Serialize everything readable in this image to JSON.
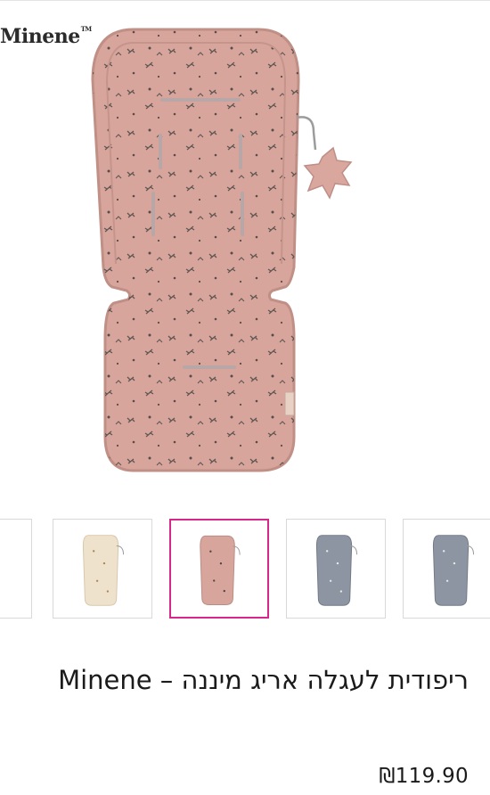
{
  "brand": {
    "name": "Minene",
    "tm": "TM"
  },
  "product": {
    "title": "ריפודית לעגלה אריג מיננה – Minene",
    "price": "₪119.90",
    "tag_label": "Minene"
  },
  "gallery": {
    "selected_index": 2,
    "thumbnails": [
      {
        "color": "pink",
        "partial": true
      },
      {
        "color": "cream"
      },
      {
        "color": "pink"
      },
      {
        "color": "grey"
      },
      {
        "color": "grey",
        "partial": true
      }
    ]
  },
  "colors": {
    "pad_pink": "#d7a59c",
    "pad_pink_edge": "#c08f86",
    "pad_cream": "#efe2cc",
    "pad_grey": "#8d95a2",
    "selected_border": "#d6288a"
  }
}
